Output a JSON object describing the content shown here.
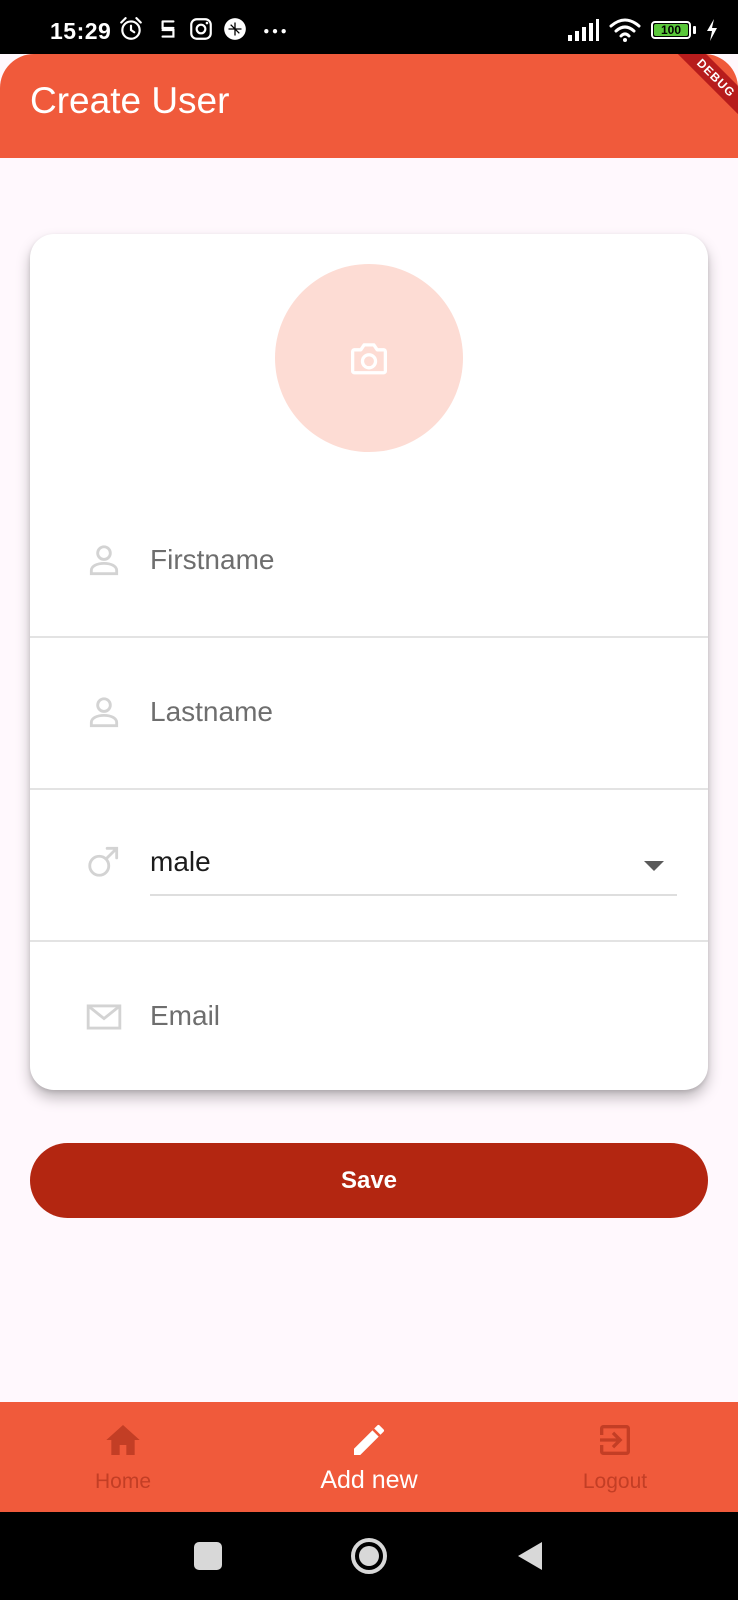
{
  "status_bar": {
    "time": "15:29",
    "battery_level": "100",
    "icons": [
      "alarm-icon",
      "notification-icon",
      "instagram-icon",
      "app-icon",
      "more-icon",
      "signal-icon",
      "wifi-icon",
      "battery-icon",
      "charging-icon"
    ]
  },
  "app_bar": {
    "title": "Create User",
    "debug_banner": "DEBUG"
  },
  "form": {
    "avatar_icon": "camera-icon",
    "firstname": {
      "placeholder": "Firstname",
      "value": "",
      "icon": "person-icon"
    },
    "lastname": {
      "placeholder": "Lastname",
      "value": "",
      "icon": "person-icon"
    },
    "gender": {
      "selected": "male",
      "icon": "male-icon"
    },
    "email": {
      "placeholder": "Email",
      "value": "",
      "icon": "mail-icon"
    },
    "save_label": "Save"
  },
  "bottom_nav": {
    "items": [
      {
        "label": "Home",
        "icon": "home-icon",
        "active": false
      },
      {
        "label": "Add new",
        "icon": "edit-icon",
        "active": true
      },
      {
        "label": "Logout",
        "icon": "logout-icon",
        "active": false
      }
    ]
  },
  "colors": {
    "primary": "#f05a3b",
    "save_button": "#b32611",
    "avatar_bg": "#fddcd4",
    "nav_inactive": "#c33e25",
    "background": "#fff8fd"
  }
}
